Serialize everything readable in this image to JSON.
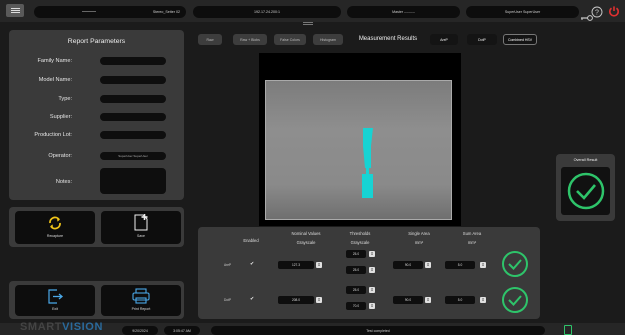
{
  "header": {
    "station": "Stereo_Setter 02",
    "ip": "192.17.24.200:1",
    "role": "Master ---------",
    "user": "SuperUser SuperUser"
  },
  "params": {
    "title": "Report Parameters",
    "family_label": "Family Name:",
    "model_label": "Model Name:",
    "type_label": "Type:",
    "supplier_label": "Supplier:",
    "lot_label": "Production Lot:",
    "operator_label": "Operator:",
    "operator_value": "SuperUser SuperUser",
    "notes_label": "Notes:"
  },
  "buttons": {
    "recapture": "Recapture",
    "save": "Save",
    "exit": "Exit",
    "print": "Print Report"
  },
  "toolbar": {
    "raw": "Raw",
    "raw_blobs": "Raw + Blobs",
    "false_colors": "False Colors",
    "histogram": "Histogram",
    "title": "Measurement Results",
    "areap": "AreP",
    "dotp": "DotP",
    "combined": "Combined HSV"
  },
  "result": {
    "label": "Overall Result"
  },
  "table": {
    "enabled": "Enabled",
    "nominal": "Nominal Values",
    "nominal_sub": "Grayscale",
    "thresholds": "Thresholds",
    "thresholds_sub": "Grayscale",
    "single": "Single Area",
    "single_sub": "mm²",
    "sum": "Sum Area",
    "sum_sub": "mm²",
    "rows": [
      {
        "name": "AreP",
        "nominal": "127.3",
        "th_hi": "25.0",
        "th_lo": "25.0",
        "single": "90.0",
        "sum": "5.0"
      },
      {
        "name": "DotP",
        "nominal": "208.0",
        "th_hi": "25.0",
        "th_lo": "70.0",
        "single": "90.0",
        "sum": "5.0"
      }
    ]
  },
  "footer": {
    "brand_a": "SMART",
    "brand_b": "VISION",
    "date": "9/20/2024",
    "time": "3:05:47 AM",
    "status": "Test completed"
  },
  "colors": {
    "accent": "#17d3d3",
    "ok": "#2ec46a",
    "power": "#e03030",
    "recapture": "#f0c419"
  }
}
